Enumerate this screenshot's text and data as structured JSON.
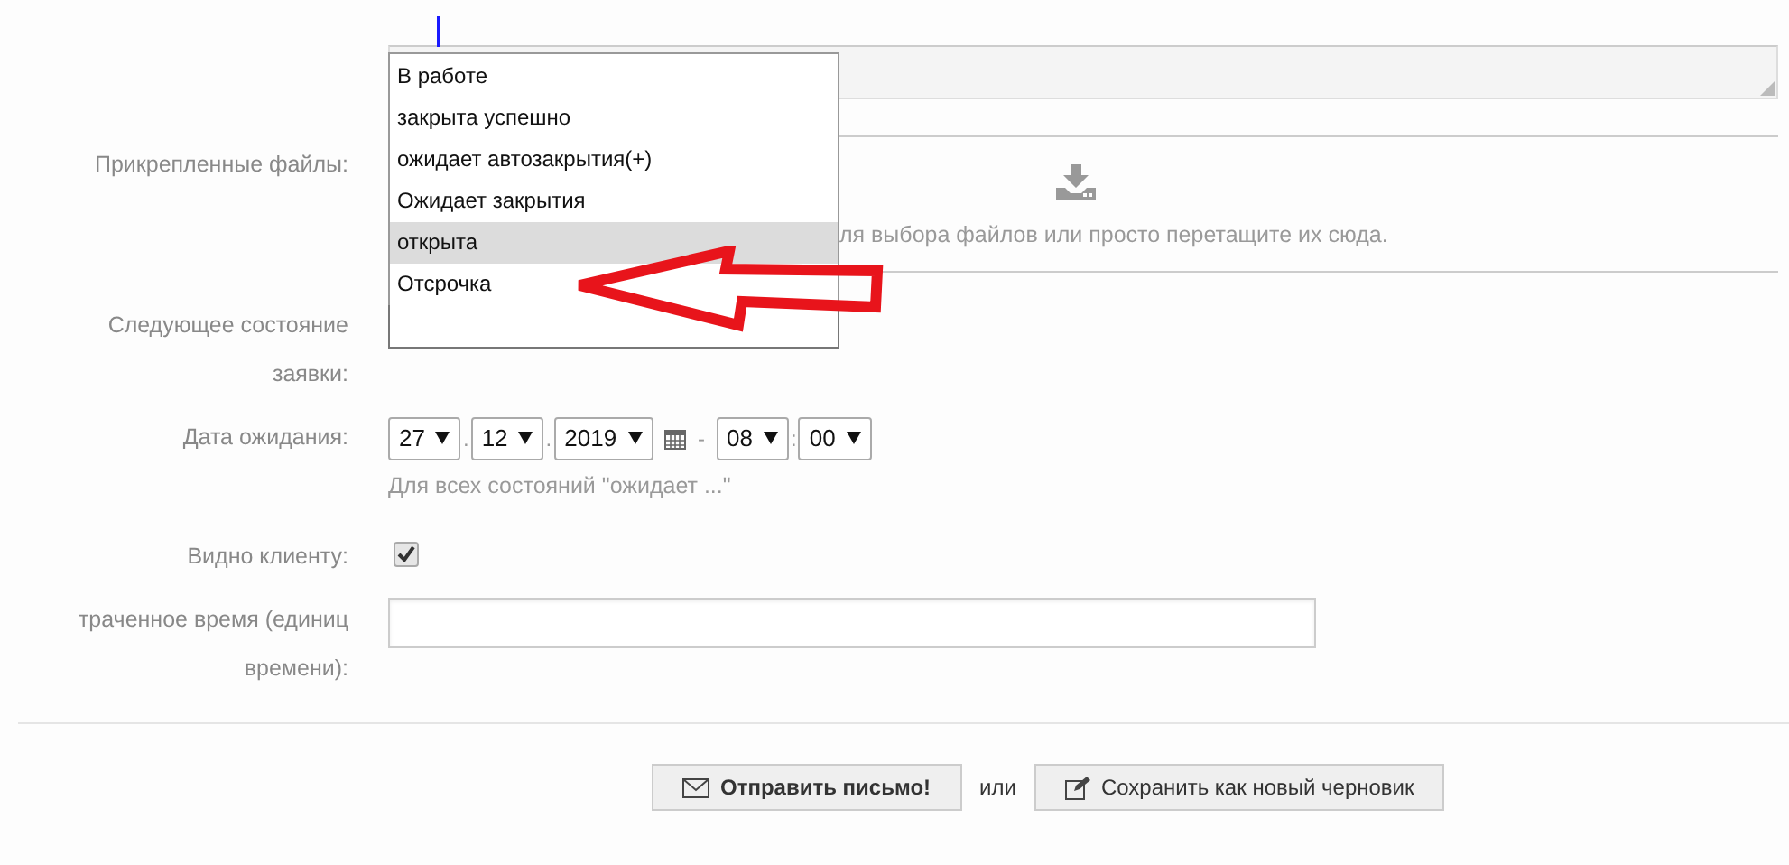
{
  "status_list": {
    "options": [
      {
        "label": "В работе",
        "selected": false
      },
      {
        "label": "закрыта успешно",
        "selected": false
      },
      {
        "label": "ожидает автозакрытия(+)",
        "selected": false
      },
      {
        "label": "Ожидает закрытия",
        "selected": false
      },
      {
        "label": "открыта",
        "selected": true
      },
      {
        "label": "Отсрочка",
        "selected": false
      }
    ]
  },
  "attachments": {
    "label": "Прикрепленные файлы:",
    "hint": "ля выбора файлов или просто перетащите их сюда."
  },
  "next_state": {
    "label": "Следующее состояние заявки:"
  },
  "wait_date": {
    "label": "Дата ожидания:",
    "day": "27",
    "month": "12",
    "year": "2019",
    "date_sep": ".",
    "time_sep": "-",
    "hour": "08",
    "minute_sep": ":",
    "minute": "00",
    "hint": "Для всех состояний \"ожидает ...\""
  },
  "visible_to_client": {
    "label": "Видно клиенту:",
    "checked": true
  },
  "time_spent": {
    "label": "траченное время (единиц времени):"
  },
  "actions": {
    "send": "Отправить письмо!",
    "or": "или",
    "save_draft": "Сохранить как новый черновик"
  }
}
